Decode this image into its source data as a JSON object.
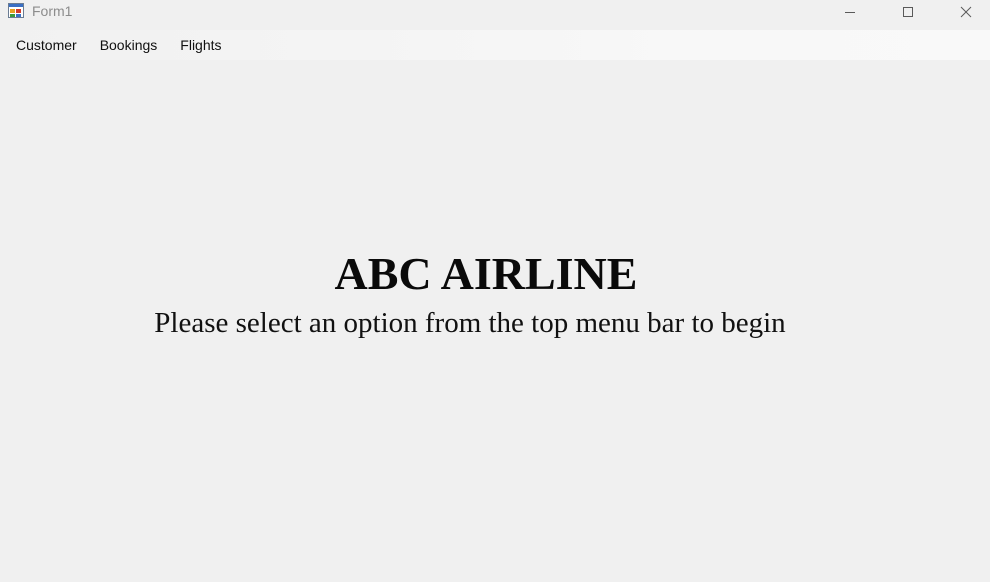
{
  "window": {
    "title": "Form1",
    "app_icon": "winforms-app-icon",
    "caption_buttons": {
      "minimize_icon": "minimize-icon",
      "maximize_icon": "maximize-icon",
      "close_icon": "close-icon"
    }
  },
  "menubar": {
    "items": [
      {
        "label": "Customer"
      },
      {
        "label": "Bookings"
      },
      {
        "label": "Flights"
      }
    ]
  },
  "main": {
    "title": "ABC AIRLINE",
    "subtitle": "Please select an option from the top menu bar to begin"
  },
  "colors": {
    "background": "#f0f0f0",
    "text": "#0a0a0a",
    "title_text_inactive": "#8c8c8c"
  }
}
